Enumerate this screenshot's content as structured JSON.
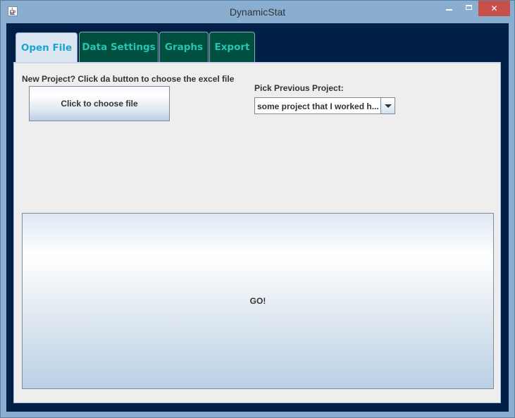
{
  "window": {
    "title": "DynamicStat"
  },
  "tabs": [
    {
      "label": "Open File",
      "active": true
    },
    {
      "label": "Data Settings",
      "active": false
    },
    {
      "label": "Graphs",
      "active": false
    },
    {
      "label": "Export",
      "active": false
    }
  ],
  "open_file": {
    "new_project_label": "New Project? Click da button to choose the excel file",
    "choose_button_label": "Click to choose file",
    "pick_previous_label": "Pick Previous Project:",
    "previous_project_selected": "some project that I worked h...",
    "go_button_label": "GO!"
  },
  "colors": {
    "frame": "#8aaed0",
    "client_background": "#002048",
    "inactive_tab": "#005040",
    "inactive_tab_text": "#28c4b4",
    "active_tab_text": "#1ca4d0",
    "panel_background": "#eeeeee",
    "close_button": "#c7504a"
  },
  "icons": [
    "java-icon",
    "minimize-icon",
    "maximize-icon",
    "close-icon",
    "dropdown-arrow-icon"
  ]
}
